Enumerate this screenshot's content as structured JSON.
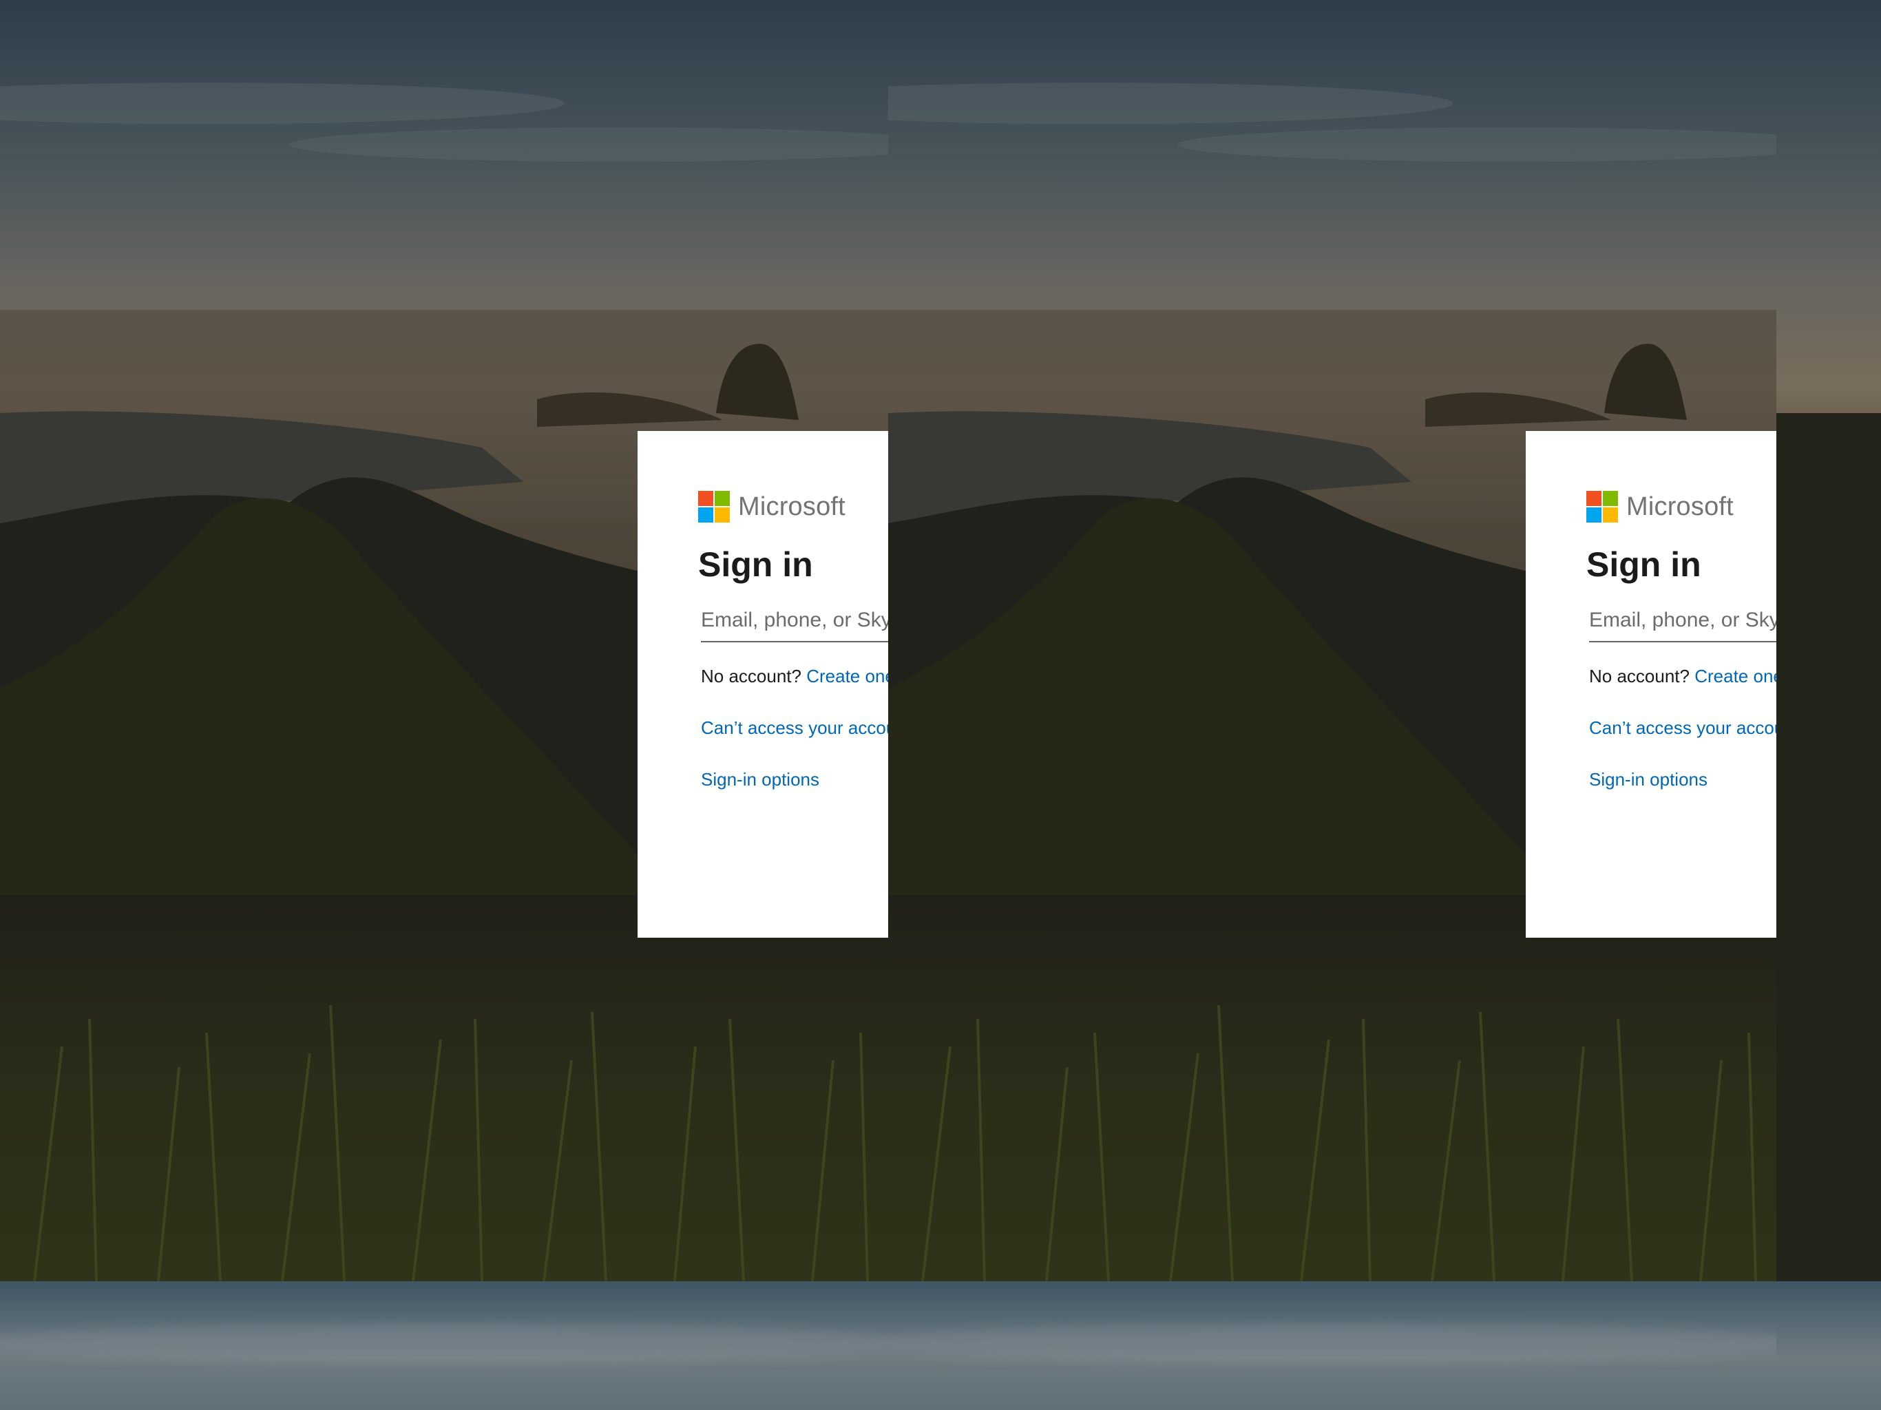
{
  "brand": {
    "name": "Microsoft"
  },
  "login": {
    "title": "Sign in",
    "email_placeholder": "Email, phone, or Skype",
    "no_account_text": "No account?",
    "create_link": "Create one!",
    "cant_access_link": "Can’t access your account?",
    "signin_options_link": "Sign-in options"
  },
  "colors": {
    "ms_red": "#f25022",
    "ms_green": "#7fba00",
    "ms_blue": "#00a4ef",
    "ms_yellow": "#ffb900",
    "link": "#0067b8"
  }
}
